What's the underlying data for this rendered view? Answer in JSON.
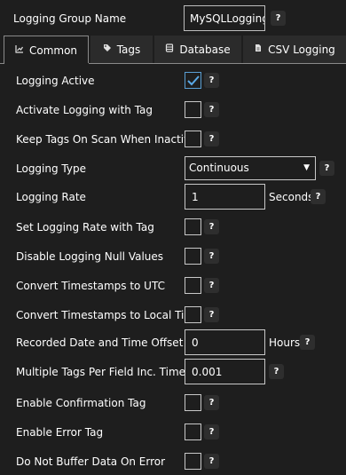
{
  "header": {
    "group_name_label": "Logging Group Name",
    "group_name_value": "MySQLLogging",
    "help": "?"
  },
  "tabs": [
    {
      "label": "Common",
      "icon": "chart-icon"
    },
    {
      "label": "Tags",
      "icon": "tag-icon"
    },
    {
      "label": "Database",
      "icon": "database-icon"
    },
    {
      "label": "CSV Logging",
      "icon": "file-icon"
    }
  ],
  "fields": {
    "logging_active": {
      "label": "Logging Active",
      "checked": true
    },
    "activate_with_tag": {
      "label": "Activate Logging with Tag",
      "checked": false
    },
    "keep_tags_on_scan": {
      "label": "Keep Tags On Scan When Inactive",
      "checked": false
    },
    "logging_type": {
      "label": "Logging Type",
      "value": "Continuous"
    },
    "logging_rate": {
      "label": "Logging Rate",
      "value": "1",
      "unit": "Seconds"
    },
    "set_rate_with_tag": {
      "label": "Set Logging Rate with Tag",
      "checked": false
    },
    "disable_null": {
      "label": "Disable Logging Null Values",
      "checked": false
    },
    "convert_utc": {
      "label": "Convert Timestamps to UTC",
      "checked": false
    },
    "convert_local": {
      "label": "Convert Timestamps to Local Time",
      "checked": false
    },
    "recorded_offset": {
      "label": "Recorded Date and Time Offset",
      "value": "0",
      "unit": "Hours"
    },
    "multi_tags_inc": {
      "label": "Multiple Tags Per Field Inc. Time",
      "value": "0.001"
    },
    "enable_confirm": {
      "label": "Enable Confirmation Tag",
      "checked": false
    },
    "enable_error": {
      "label": "Enable Error Tag",
      "checked": false
    },
    "no_buffer": {
      "label": "Do Not Buffer Data On Error",
      "checked": false
    }
  }
}
